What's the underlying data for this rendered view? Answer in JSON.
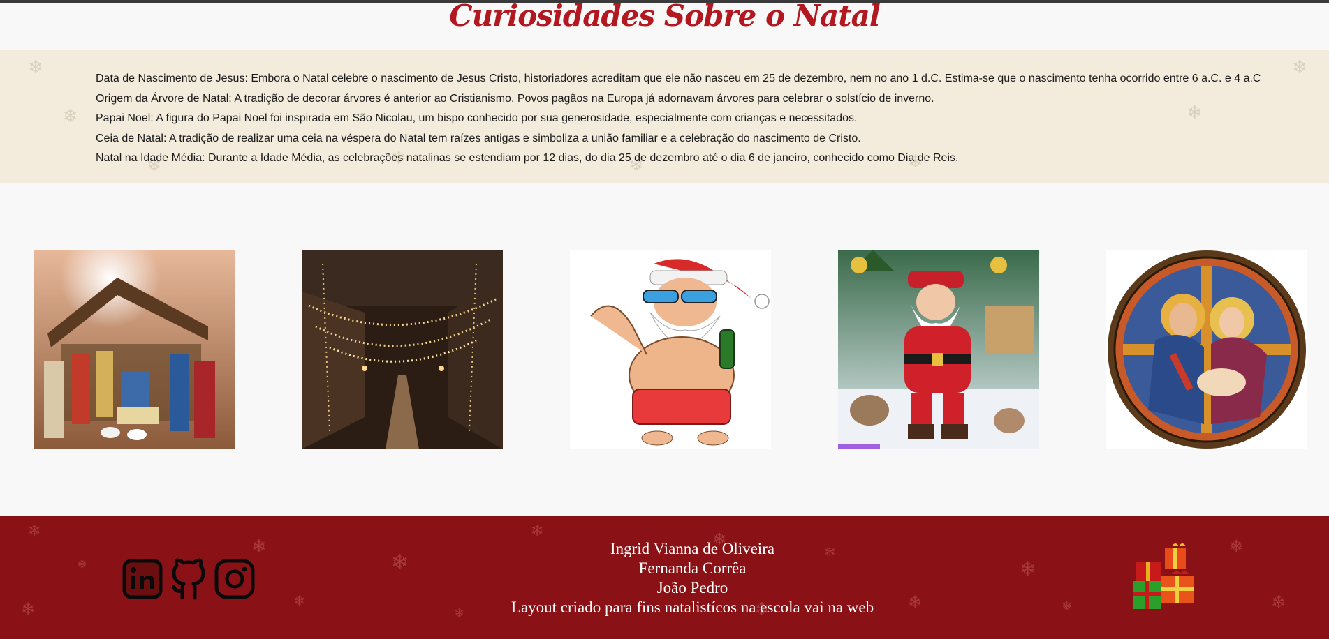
{
  "page": {
    "title": "Curiosidades Sobre o Natal"
  },
  "facts": [
    "Data de Nascimento de Jesus: Embora o Natal celebre o nascimento de Jesus Cristo, historiadores acreditam que ele não nasceu em 25 de dezembro, nem no ano 1 d.C. Estima-se que o nascimento tenha ocorrido entre 6 a.C. e 4 a.C",
    "Origem da Árvore de Natal: A tradição de decorar árvores é anterior ao Cristianismo. Povos pagãos na Europa já adornavam árvores para celebrar o solstício de inverno.",
    "Papai Noel: A figura do Papai Noel foi inspirada em São Nicolau, um bispo conhecido por sua generosidade, especialmente com crianças e necessitados.",
    "Ceia de Natal: A tradição de realizar uma ceia na véspera do Natal tem raízes antigas e simboliza a união familiar e a celebração do nascimento de Cristo.",
    "Natal na Idade Média: Durante a Idade Média, as celebrações natalinas se estendiam por 12 dias, do dia 25 de dezembro até o dia 6 de janeiro, conhecido como Dia de Reis."
  ],
  "gallery": [
    {
      "name": "nativity-scene-image"
    },
    {
      "name": "lit-street-image"
    },
    {
      "name": "beach-santa-image"
    },
    {
      "name": "santa-claus-image"
    },
    {
      "name": "stained-glass-holy-family-image"
    }
  ],
  "footer": {
    "social_icons": [
      "linkedin-icon",
      "github-icon",
      "instagram-icon"
    ],
    "credits": [
      "Ingrid Vianna de Oliveira",
      "Fernanda Corrêa",
      "João Pedro",
      "Layout criado para fins natalistícos na escola vai na web"
    ],
    "gift_icon": "gift-boxes-icon"
  },
  "colors": {
    "title": "#b3171f",
    "facts_bg": "#f3ecdc",
    "footer_bg": "#8a1216",
    "page_bg": "#f8f8f8"
  }
}
